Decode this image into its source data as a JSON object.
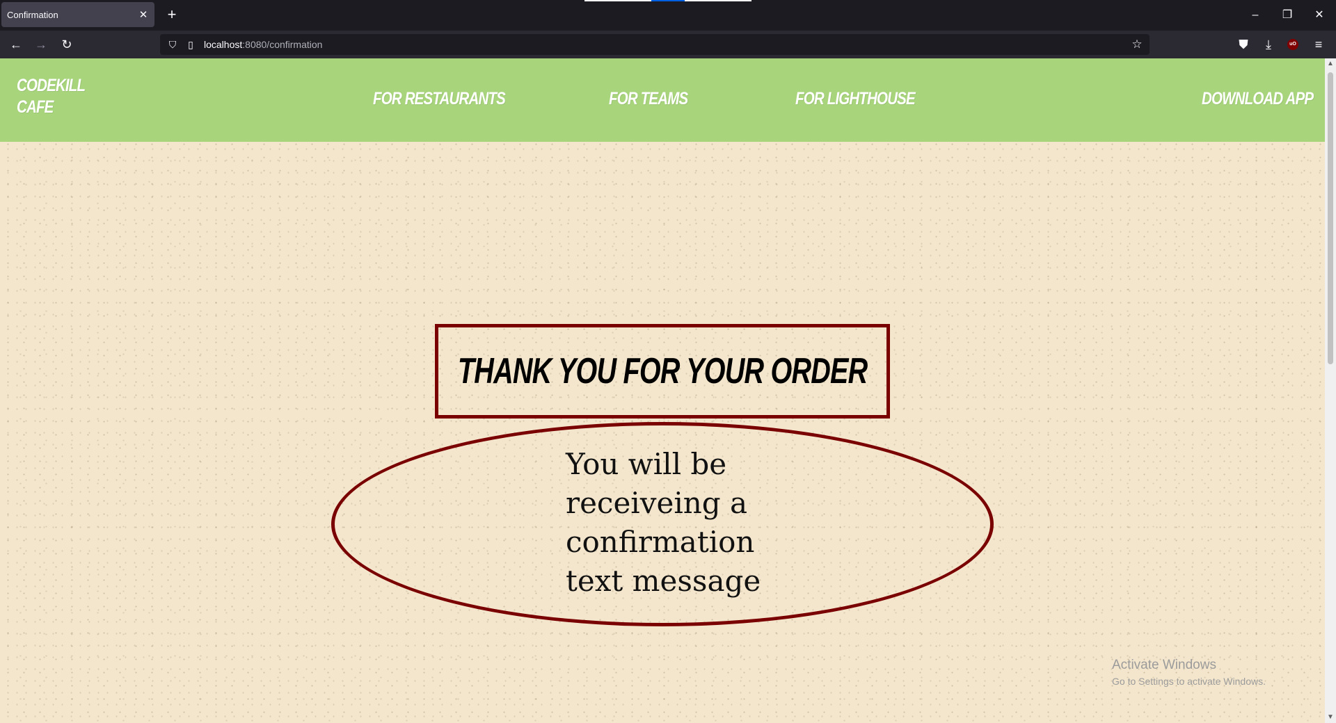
{
  "browser": {
    "tab_title": "Confirmation",
    "tab_close_icon": "close-icon",
    "new_tab_icon": "plus-icon",
    "url_host": "localhost",
    "url_rest": ":8080/confirmation",
    "window_controls": [
      "minimize-icon",
      "restore-icon",
      "close-icon"
    ],
    "toolbar_icons": [
      "pocket-icon",
      "download-icon",
      "ublock-icon",
      "menu-icon"
    ],
    "ublock_label": "uO"
  },
  "header": {
    "logo": "CODEKILL CAFE",
    "nav": {
      "restaurants": "FOR RESTAURANTS",
      "teams": "FOR TEAMS",
      "lighthouse": "FOR LIGHTHOUSE",
      "download": "DOWNLOAD APP"
    },
    "color": "#a8d47c"
  },
  "main": {
    "heading": "THANK YOU FOR YOUR ORDER",
    "message": "You will be receiveing a confirmation text message",
    "border_color": "#7a0000",
    "background": "#f3e6cc"
  },
  "watermark": {
    "line1": "Activate Windows",
    "line2": "Go to Settings to activate Windows."
  }
}
